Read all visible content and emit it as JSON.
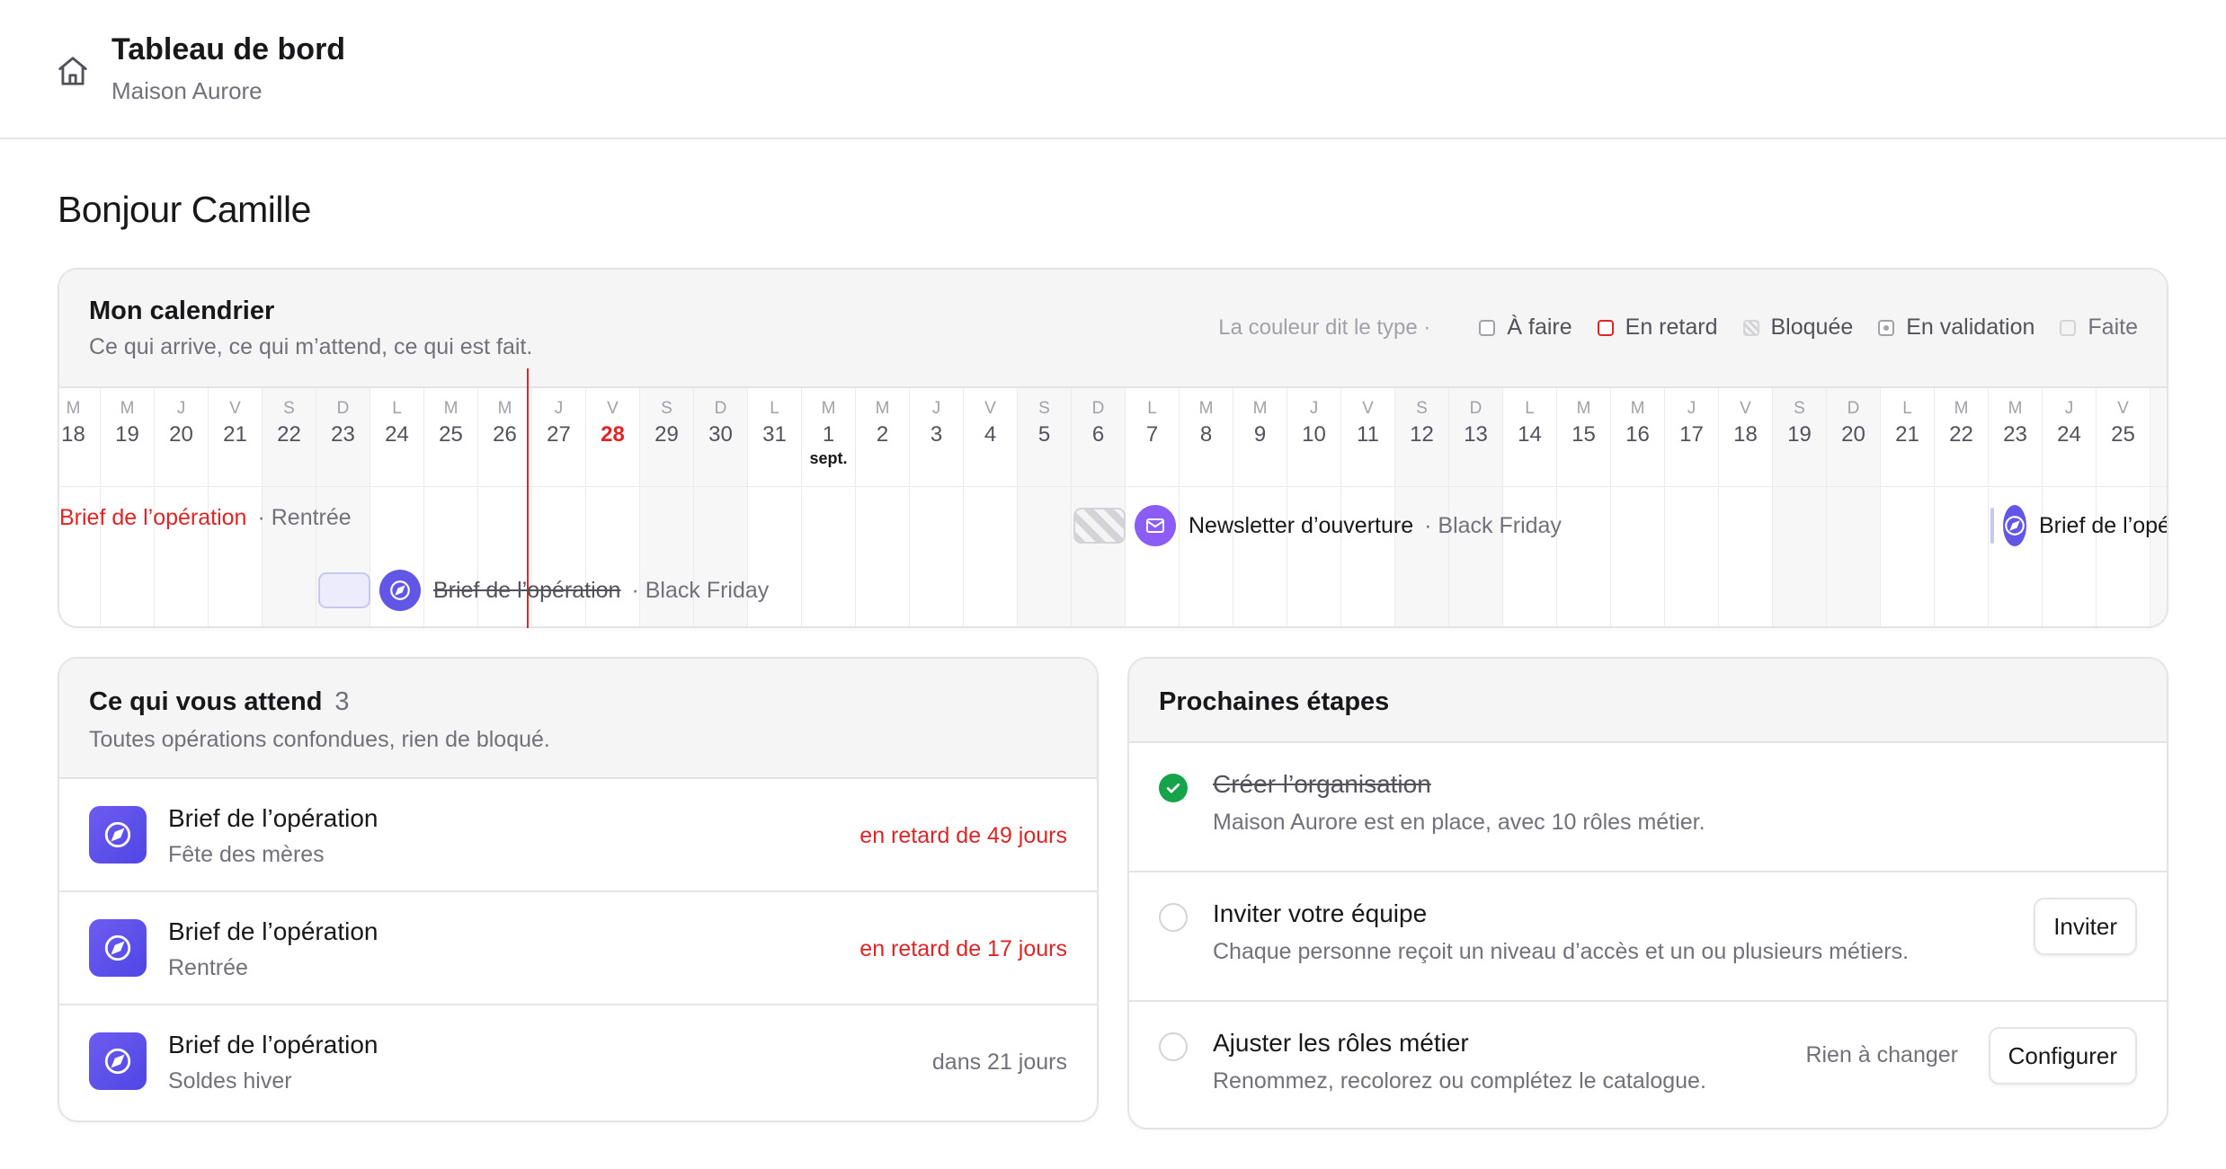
{
  "header": {
    "title": "Tableau de bord",
    "subtitle": "Maison Aurore",
    "icon": "home-icon"
  },
  "greeting": "Bonjour Camille",
  "calendar": {
    "title": "Mon calendrier",
    "subtitle": "Ce qui arrive, ce qui m’attend, ce qui est fait.",
    "legend_lead": "La couleur dit le type ·",
    "legend": [
      "À faire",
      "En retard",
      "Bloquée",
      "En validation",
      "Faite"
    ],
    "days": [
      {
        "d": "M",
        "n": "18"
      },
      {
        "d": "M",
        "n": "19"
      },
      {
        "d": "J",
        "n": "20"
      },
      {
        "d": "V",
        "n": "21"
      },
      {
        "d": "S",
        "n": "22",
        "we": true
      },
      {
        "d": "D",
        "n": "23",
        "we": true
      },
      {
        "d": "L",
        "n": "24"
      },
      {
        "d": "M",
        "n": "25"
      },
      {
        "d": "M",
        "n": "26"
      },
      {
        "d": "J",
        "n": "27"
      },
      {
        "d": "V",
        "n": "28",
        "today": true
      },
      {
        "d": "S",
        "n": "29",
        "we": true
      },
      {
        "d": "D",
        "n": "30",
        "we": true
      },
      {
        "d": "L",
        "n": "31"
      },
      {
        "d": "M",
        "n": "1",
        "month": "sept."
      },
      {
        "d": "M",
        "n": "2"
      },
      {
        "d": "J",
        "n": "3"
      },
      {
        "d": "V",
        "n": "4"
      },
      {
        "d": "S",
        "n": "5",
        "we": true
      },
      {
        "d": "D",
        "n": "6",
        "we": true
      },
      {
        "d": "L",
        "n": "7"
      },
      {
        "d": "M",
        "n": "8"
      },
      {
        "d": "M",
        "n": "9"
      },
      {
        "d": "J",
        "n": "10"
      },
      {
        "d": "V",
        "n": "11"
      },
      {
        "d": "S",
        "n": "12",
        "we": true
      },
      {
        "d": "D",
        "n": "13",
        "we": true
      },
      {
        "d": "L",
        "n": "14"
      },
      {
        "d": "M",
        "n": "15"
      },
      {
        "d": "M",
        "n": "16"
      },
      {
        "d": "J",
        "n": "17"
      },
      {
        "d": "V",
        "n": "18"
      },
      {
        "d": "S",
        "n": "19",
        "we": true
      },
      {
        "d": "D",
        "n": "20",
        "we": true
      },
      {
        "d": "L",
        "n": "21"
      },
      {
        "d": "M",
        "n": "22"
      },
      {
        "d": "M",
        "n": "23"
      },
      {
        "d": "J",
        "n": "24"
      },
      {
        "d": "V",
        "n": "25"
      },
      {
        "d": "S",
        "n": "",
        "we": true
      }
    ],
    "events": {
      "e1_title": "Brief de l’opération",
      "e1_meta": "· Rentrée",
      "e2_title": "Brief de l’opération",
      "e2_meta": "· Black Friday",
      "e3_title": "Newsletter d’ouverture",
      "e3_meta": "· Black Friday",
      "e4_title": "Brief de l’opération"
    }
  },
  "todo": {
    "title": "Ce qui vous attend",
    "count": "3",
    "subtitle": "Toutes opérations confondues, rien de bloqué.",
    "items": [
      {
        "title": "Brief de l’opération",
        "sub": "Fête des mères",
        "due": "en retard de 49 jours",
        "late": true
      },
      {
        "title": "Brief de l’opération",
        "sub": "Rentrée",
        "due": "en retard de 17 jours",
        "late": true
      },
      {
        "title": "Brief de l’opération",
        "sub": "Soldes hiver",
        "due": "dans 21 jours",
        "late": false
      }
    ]
  },
  "steps": {
    "title": "Prochaines étapes",
    "items": [
      {
        "title": "Créer l’organisation",
        "sub": "Maison Aurore est en place, avec 10 rôles métier.",
        "done": true
      },
      {
        "title": "Inviter votre équipe",
        "sub": "Chaque personne reçoit un niveau d’accès et un ou plusieurs métiers.",
        "button": "Inviter"
      },
      {
        "title": "Ajuster les rôles métier",
        "sub": "Renommez, recolorez ou complétez le catalogue.",
        "note": "Rien à changer",
        "button": "Configurer"
      }
    ]
  },
  "colors": {
    "accent": "#6156e6",
    "late": "#dc2626",
    "success": "#16a34a"
  }
}
